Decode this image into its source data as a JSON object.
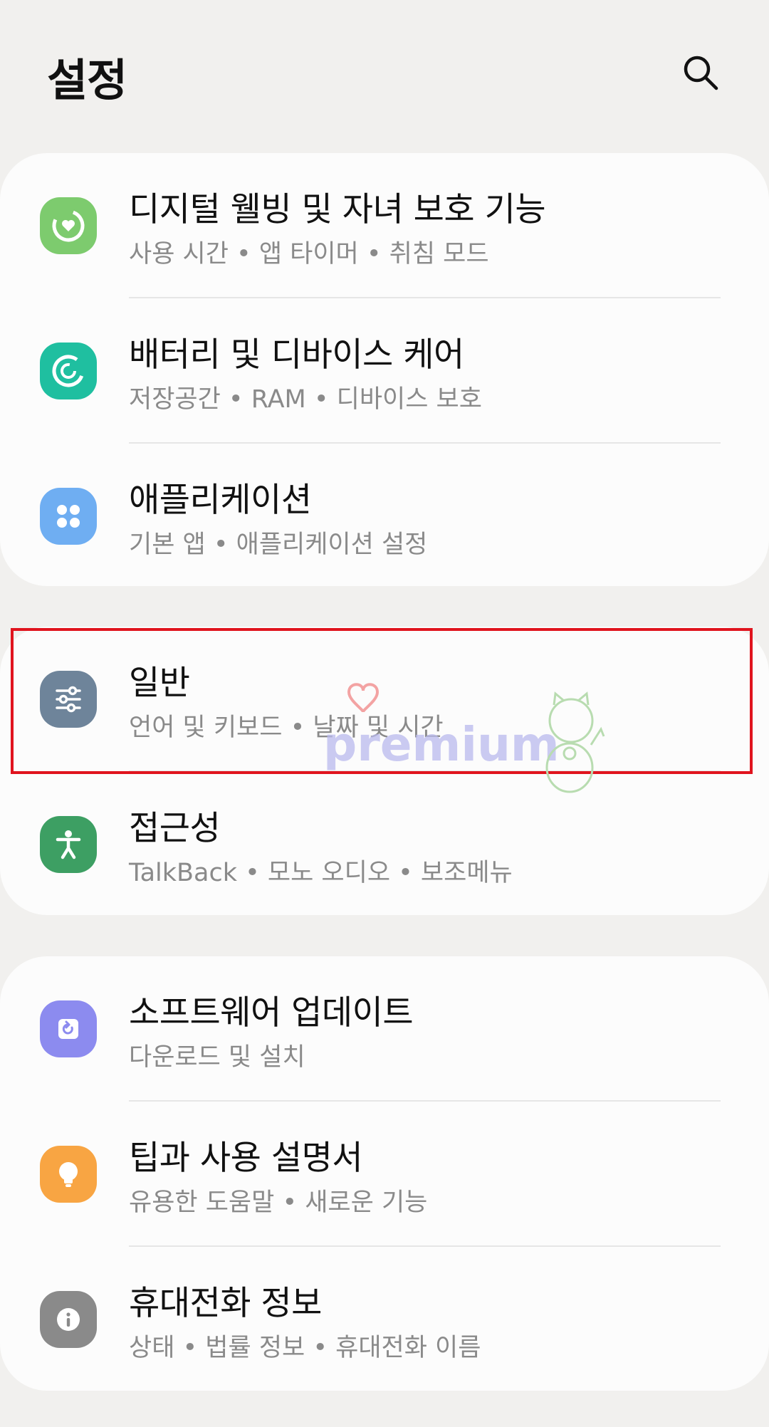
{
  "header": {
    "title": "설정",
    "search_icon": "search-icon"
  },
  "groups": [
    {
      "items": [
        {
          "title": "디지털 웰빙 및 자녀 보호 기능",
          "subtitle": "사용 시간  •  앱 타이머  •  취침 모드",
          "icon": "wellbeing-icon",
          "color": "#7dcb6e"
        },
        {
          "title": "배터리 및 디바이스 케어",
          "subtitle": "저장공간  •  RAM  •  디바이스 보호",
          "icon": "device-care-icon",
          "color": "#1fbfa0"
        },
        {
          "title": "애플리케이션",
          "subtitle": "기본 앱  •  애플리케이션 설정",
          "icon": "apps-icon",
          "color": "#6faef2"
        }
      ]
    },
    {
      "items": [
        {
          "title": "일반",
          "subtitle": "언어 및 키보드  •  날짜 및 시간",
          "icon": "sliders-icon",
          "color": "#6e849a"
        },
        {
          "title": "접근성",
          "subtitle": "TalkBack  •  모노 오디오  •  보조메뉴",
          "icon": "accessibility-icon",
          "color": "#3d9f63"
        }
      ]
    },
    {
      "items": [
        {
          "title": "소프트웨어 업데이트",
          "subtitle": "다운로드 및 설치",
          "icon": "update-icon",
          "color": "#8c8bef"
        },
        {
          "title": "팁과 사용 설명서",
          "subtitle": "유용한 도움말  •  새로운 기능",
          "icon": "lightbulb-icon",
          "color": "#f8a543"
        },
        {
          "title": "휴대전화 정보",
          "subtitle": "상태  •  법률 정보  •  휴대전화 이름",
          "icon": "info-icon",
          "color": "#8a8a8a"
        }
      ]
    }
  ],
  "highlight": {
    "target": "groups.1.items.0",
    "color": "#e0141e"
  },
  "watermark": {
    "text": "premium"
  }
}
